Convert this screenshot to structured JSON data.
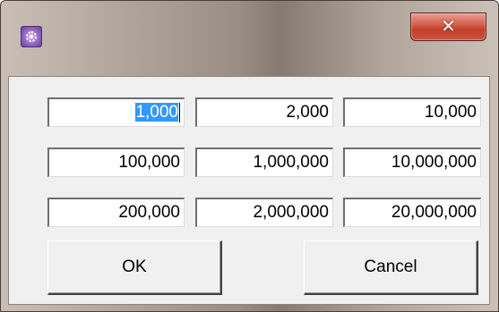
{
  "window": {
    "icon": "app-gear-icon",
    "close_glyph": "✕"
  },
  "fields": [
    {
      "value": "1,000",
      "selected": true
    },
    {
      "value": "2,000"
    },
    {
      "value": "10,000"
    },
    {
      "value": "100,000"
    },
    {
      "value": "1,000,000"
    },
    {
      "value": "10,000,000"
    },
    {
      "value": "200,000"
    },
    {
      "value": "2,000,000"
    },
    {
      "value": "20,000,000"
    }
  ],
  "buttons": {
    "ok_label": "OK",
    "cancel_label": "Cancel"
  }
}
